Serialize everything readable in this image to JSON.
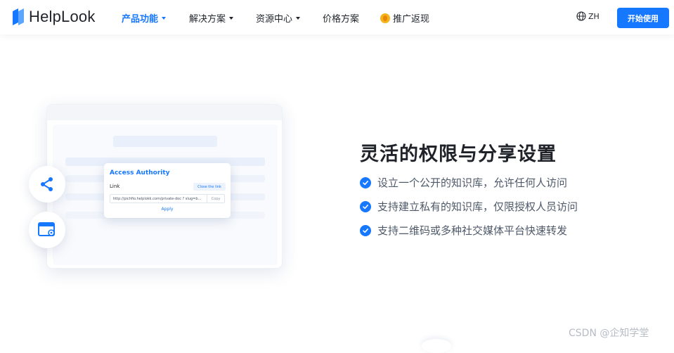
{
  "nav": {
    "logo_text": "HelpLook",
    "items": [
      {
        "label": "产品功能",
        "active": true,
        "dropdown": true
      },
      {
        "label": "解决方案",
        "active": false,
        "dropdown": true
      },
      {
        "label": "资源中心",
        "active": false,
        "dropdown": true
      },
      {
        "label": "价格方案",
        "active": false,
        "dropdown": false
      },
      {
        "label": "推广返现",
        "active": false,
        "dropdown": false,
        "icon": "coin-icon"
      }
    ],
    "language": "ZH",
    "cta": "开始使用"
  },
  "mockup": {
    "popup_title": "Access Authority",
    "link_label": "Link",
    "close_link": "Close the link",
    "url": "http://pichfio.helplokk.com/private-doc ? slug=b...",
    "copy": "Copy",
    "apply": "Apply"
  },
  "feature": {
    "title": "灵活的权限与分享设置",
    "points": [
      "设立一个公开的知识库，允许任何人访问",
      "支持建立私有的知识库，仅限授权人员访问",
      "支持二维码或多种社交媒体平台快速转发"
    ]
  },
  "watermark": "CSDN @企知学堂",
  "colors": {
    "accent": "#1677ff",
    "text": "#1f2329",
    "muted": "#4e5969"
  }
}
